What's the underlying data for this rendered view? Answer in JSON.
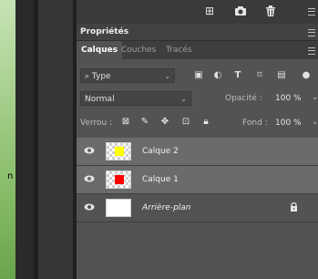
{
  "background_left_glyph": "n",
  "panel": {
    "section_title": "Propriétés",
    "tabs": [
      {
        "label": "Calques",
        "active": true
      },
      {
        "label": "Couches",
        "active": false
      },
      {
        "label": "Tracés",
        "active": false
      }
    ],
    "filter": {
      "kind_label": "Type"
    },
    "blend": {
      "mode": "Normal",
      "opacity_label": "Opacité :",
      "opacity_value": "100 %"
    },
    "lock": {
      "label": "Verrou :",
      "fill_label": "Fond :",
      "fill_value": "100 %"
    },
    "layers": [
      {
        "name": "Calque 2",
        "visible": true,
        "swatch_color": "#ffff00",
        "selected": true
      },
      {
        "name": "Calque 1",
        "visible": true,
        "swatch_color": "#ff0000",
        "selected": true
      },
      {
        "name": "Arrière-plan",
        "visible": true,
        "locked": true,
        "italic": true
      }
    ]
  },
  "colors": {
    "panel_bg": "#535353",
    "selected_row": "#6b6b6b",
    "toolbar_bg": "#3a3a3a"
  },
  "icons": [
    "camera-icon",
    "trash-icon",
    "menu-lines-icon",
    "search-icon",
    "image-filter-icon",
    "adjustment-filter-icon",
    "type-filter-icon",
    "shape-filter-icon",
    "smartobject-filter-icon",
    "lock-transparent-icon",
    "lock-paint-icon",
    "lock-move-icon",
    "lock-artboard-icon",
    "lock-all-icon",
    "eye-icon",
    "lock-icon"
  ]
}
